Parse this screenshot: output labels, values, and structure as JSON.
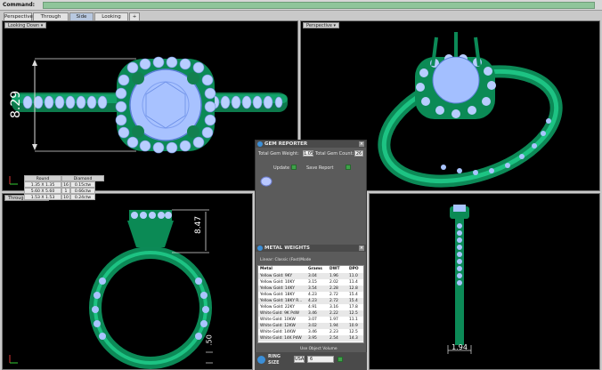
{
  "command": {
    "label": "Command:",
    "value": ""
  },
  "tabs": [
    {
      "label": "Perspective",
      "active": false
    },
    {
      "label": "Through Finger",
      "active": false
    },
    {
      "label": "Side View",
      "active": true
    },
    {
      "label": "Looking Down",
      "active": false
    },
    {
      "label": "+",
      "active": false
    }
  ],
  "viewports": {
    "top_left": {
      "label": "Looking Down ▾",
      "dimension": "8.29"
    },
    "top_right": {
      "label": "Perspective ▾"
    },
    "bottom_left": {
      "label": "Through Finger ▾",
      "dimension_a": "8.47",
      "dimension_b": ".50"
    },
    "bottom_right": {
      "label": "",
      "dimension": "1.94"
    }
  },
  "gem_reporter": {
    "title": "GEM REPORTER",
    "total_weight_label": "Total Gem Weight:",
    "total_weight_value": "1.05",
    "total_count_label": "Total Gem Count:",
    "total_count_value": "26",
    "update_label": "Update",
    "save_label": "Save Report",
    "table": {
      "headers": [
        "Round",
        "Diamond"
      ],
      "rows": [
        {
          "size": "1.35 X 1.35",
          "count": "16",
          "weight": "0.15ctw"
        },
        {
          "size": "5.60 X 5.60",
          "count": "1",
          "weight": "0.66ctw"
        },
        {
          "size": "1.53 X 1.53",
          "count": "10",
          "weight": "0.24ctw"
        }
      ]
    }
  },
  "metal_weights": {
    "title": "METAL WEIGHTS",
    "subtitle": "Linear: Classic (Fast)Mode",
    "headers": [
      "Metal",
      "Grams",
      "DWT",
      "DPO"
    ],
    "rows": [
      [
        "Yellow Gold: 9KY",
        "3.04",
        "1.96",
        "11.0"
      ],
      [
        "Yellow Gold: 10KY",
        "3.15",
        "2.02",
        "11.4"
      ],
      [
        "Yellow Gold: 14KY",
        "3.54",
        "2.28",
        "12.8"
      ],
      [
        "Yellow Gold: 18KY",
        "4.23",
        "2.72",
        "15.4"
      ],
      [
        "Yellow Gold: 18KY R...",
        "4.23",
        "2.72",
        "15.4"
      ],
      [
        "Yellow Gold: 22KY",
        "4.91",
        "3.16",
        "17.8"
      ],
      [
        "White Gold: 9K PdW",
        "3.46",
        "2.22",
        "12.5"
      ],
      [
        "White Gold: 10KW",
        "3.07",
        "1.97",
        "11.1"
      ],
      [
        "White Gold: 12KW",
        "3.02",
        "1.94",
        "10.9"
      ],
      [
        "White Gold: 14KW",
        "3.46",
        "2.23",
        "12.5"
      ],
      [
        "White Gold: 14K PdW",
        "3.95",
        "2.54",
        "14.3"
      ]
    ],
    "footer": "Use Object Volume",
    "scroll_value": "0"
  },
  "ring_size": {
    "title": "RING",
    "subtitle": "SIZE",
    "system": "USA",
    "value": "6"
  },
  "colors": {
    "metal": "#12a66a",
    "gem": "#a9c4ff",
    "background": "#000000"
  }
}
